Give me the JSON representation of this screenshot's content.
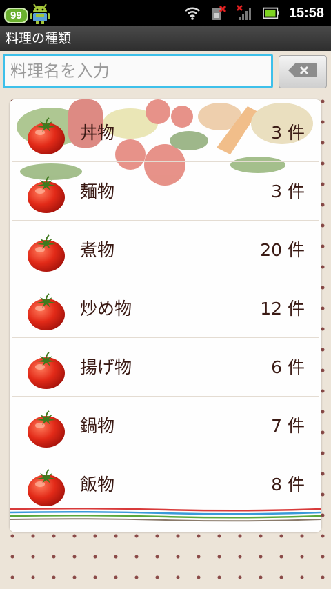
{
  "status_bar": {
    "badge": "99",
    "time": "15:58",
    "icons": [
      "android-icon",
      "wifi-icon",
      "sim-error-icon",
      "no-signal-icon",
      "battery-icon"
    ]
  },
  "app": {
    "title": "料理の種類"
  },
  "search": {
    "placeholder": "料理名を入力",
    "value": "",
    "clear_icon": "backspace-icon"
  },
  "categories": [
    {
      "label": "丼物",
      "count": "3 件"
    },
    {
      "label": "麺物",
      "count": "3 件"
    },
    {
      "label": "煮物",
      "count": "20 件"
    },
    {
      "label": "炒め物",
      "count": "12 件"
    },
    {
      "label": "揚げ物",
      "count": "6 件"
    },
    {
      "label": "鍋物",
      "count": "7 件"
    },
    {
      "label": "飯物",
      "count": "8 件"
    }
  ],
  "colors": {
    "accent": "#3ec0ea",
    "text": "#3a1a14",
    "dot": "#8a4a48"
  }
}
